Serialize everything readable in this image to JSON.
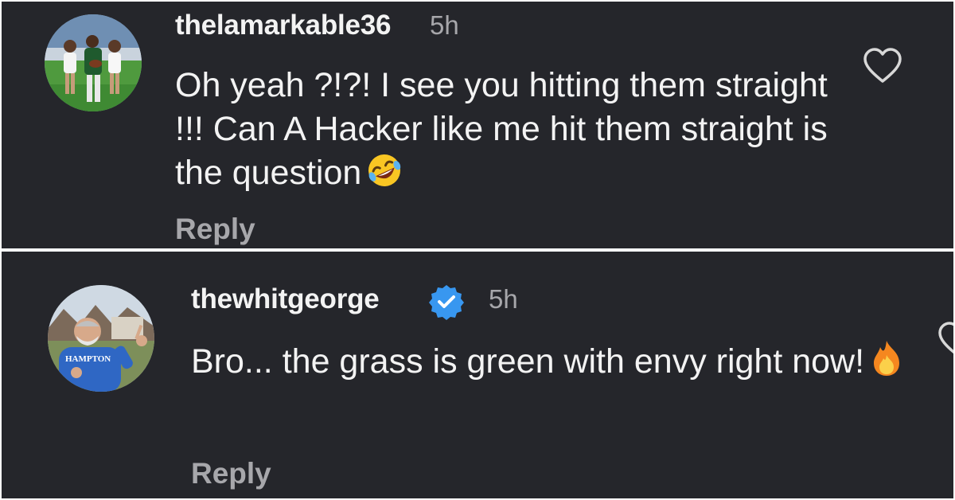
{
  "comments": [
    {
      "username": "thelamarkable36",
      "time": "5h",
      "text": "Oh yeah ?!?! I see you hitting them straight !!! Can A Hacker like me hit them straight is the question",
      "emoji": "rolling-on-floor-laughing-emoji",
      "reply_label": "Reply",
      "verified": false
    },
    {
      "username": "thewhitgeorge",
      "time": "5h",
      "text": "Bro... the grass is green with envy right now!",
      "emoji": "fire-emoji",
      "reply_label": "Reply",
      "verified": true,
      "avatar_shirt_text": "HAMPTON"
    }
  ],
  "colors": {
    "panel_bg": "#25262b",
    "text": "#f3f3f3",
    "muted": "#a7a7ab",
    "verified_blue": "#3897f0"
  }
}
